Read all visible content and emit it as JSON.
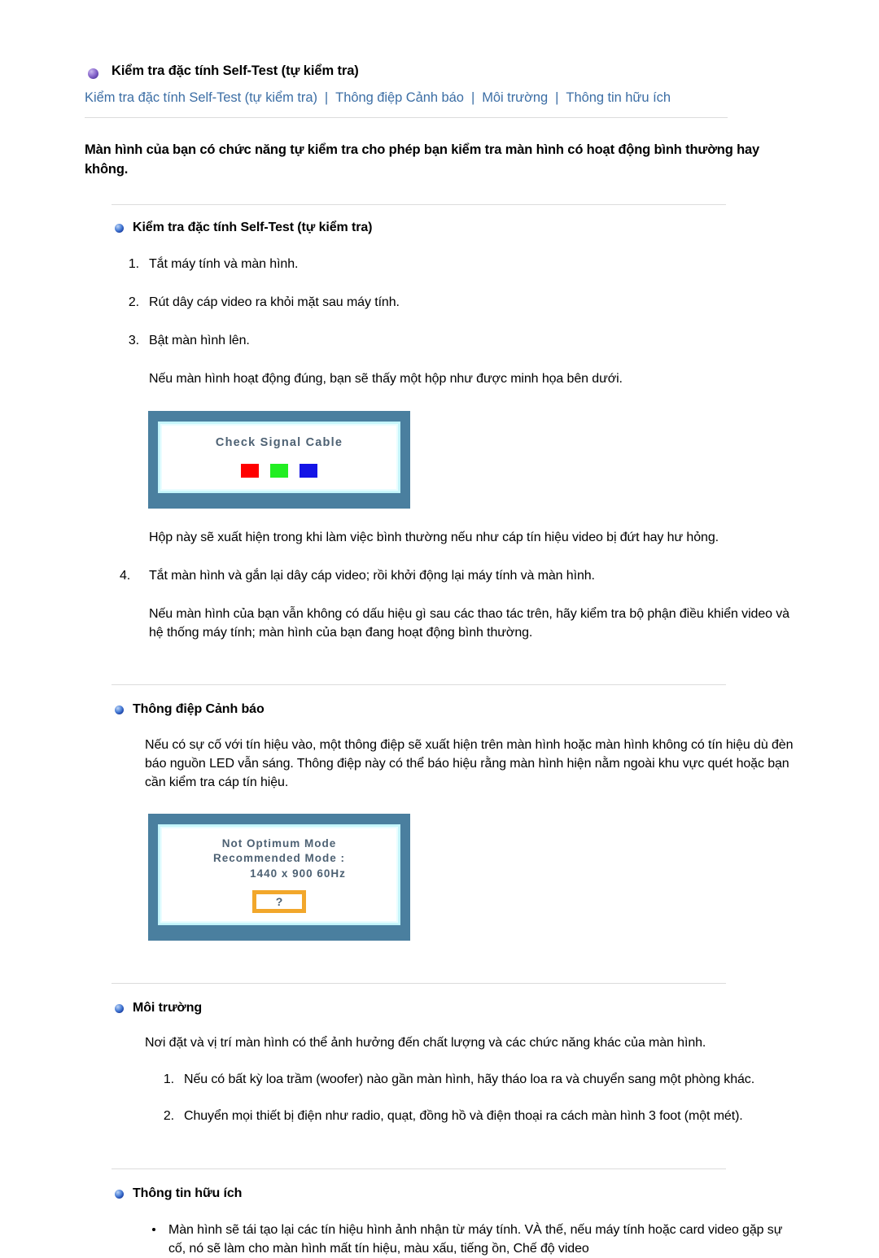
{
  "page": {
    "title": "Kiểm tra đặc tính Self-Test (tự kiểm tra)",
    "bullet_icon_top": "purple-sphere-bullet-icon",
    "bullet_icon_section": "blue-sphere-bullet-icon",
    "link_color": "#3c6ea5",
    "rule_color": "#dcdcdc"
  },
  "nav": {
    "separator": "|",
    "links": [
      "Kiểm tra đặc tính Self-Test (tự kiểm tra)",
      "Thông điệp Cảnh báo",
      "Môi trường",
      "Thông tin hữu ích"
    ]
  },
  "intro": "Màn hình của bạn có chức năng tự kiểm tra cho phép bạn kiểm tra màn hình có hoạt động bình thường hay không.",
  "section_selftest": {
    "heading": "Kiểm tra đặc tính Self-Test (tự kiểm tra)",
    "steps_1to3": [
      "Tắt máy tính và màn hình.",
      "Rút dây cáp video ra khỏi mặt sau máy tính.",
      "Bật màn hình lên."
    ],
    "after_steps_note": "Nếu màn hình hoạt động đúng, bạn sẽ thấy một hộp như được minh họa bên dưới.",
    "osd_check_cable": {
      "title": "Check Signal Cable",
      "squares": [
        "#ff0000",
        "#22ee22",
        "#1414e6"
      ],
      "frame_color": "#4a7f9f",
      "glow_color": "#c8f6fb"
    },
    "box_note": "Hộp này sẽ xuất hiện trong khi làm việc bình thường nếu như cáp tín hiệu video bị đứt hay hư hỏng.",
    "step4_number": "4.",
    "step4": "Tắt màn hình và gắn lại dây cáp video; rồi khởi động lại máy tính và màn hình.",
    "final_note": "Nếu màn hình của bạn vẫn không có dấu hiệu gì sau các thao tác trên, hãy kiểm tra bộ phận điều khiển video và hệ thống máy tính; màn hình của bạn đang hoạt động bình thường."
  },
  "section_warning": {
    "heading": "Thông điệp Cảnh báo",
    "body": "Nếu có sự cố với tín hiệu vào, một thông điệp sẽ xuất hiện trên màn hình hoặc màn hình không có tín hiệu dù đèn báo nguồn LED vẫn sáng. Thông điệp này có thể báo hiệu rằng màn hình hiện nằm ngoài khu vực quét hoặc bạn cần kiểm tra cáp tín hiệu.",
    "osd_not_optimum": {
      "line1": "Not Optimum Mode",
      "line2": "Recommended Mode :",
      "line3": "1440 x 900 60Hz",
      "question_mark": "?",
      "question_box_color": "#f2a72b",
      "frame_color": "#4a7f9f",
      "glow_color": "#c8f6fb"
    }
  },
  "section_environment": {
    "heading": "Môi trường",
    "lead": "Nơi đặt và vị trí màn hình có thể ảnh hưởng đến chất lượng và các chức năng khác của màn hình.",
    "steps": [
      "Nếu có bất kỳ loa trầm (woofer) nào gần màn hình, hãy tháo loa ra và chuyển sang một phòng khác.",
      "Chuyển mọi thiết bị điện như radio, quạt, đồng hồ và điện thoại ra cách màn hình 3 foot (một mét)."
    ]
  },
  "section_useful": {
    "heading": "Thông tin hữu ích",
    "bullets": [
      "Màn hình sẽ tái tạo lại các tín hiệu hình ảnh nhận từ máy tính. VÀ thế, nếu máy tính hoặc card video gặp sự cố, nó sẽ làm cho màn hình mất tín hiệu, màu xấu, tiếng ồn, Chế độ video"
    ]
  }
}
